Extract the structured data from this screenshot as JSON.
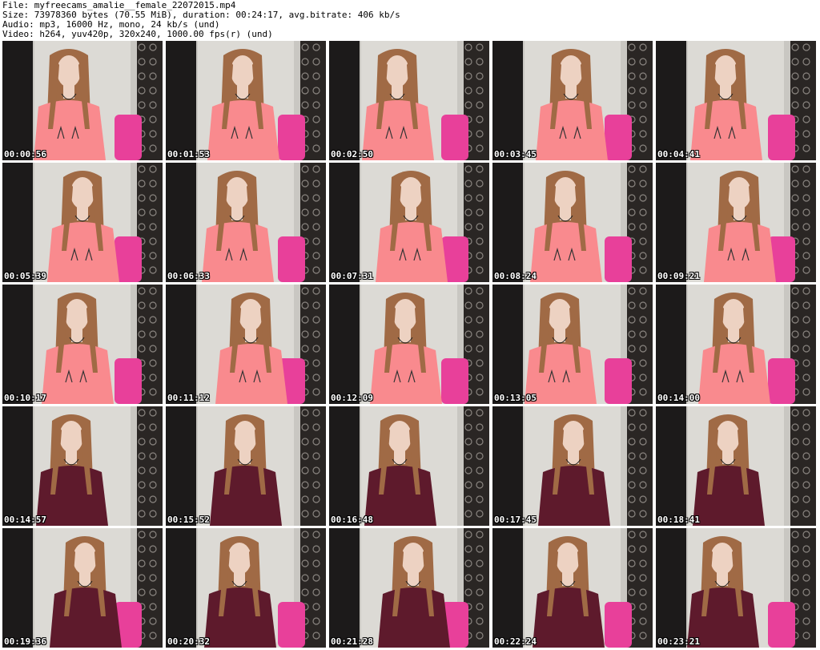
{
  "header": {
    "lines": [
      "File: myfreecams_amalie__female_22072015.mp4",
      "Size: 73978360 bytes (70.55 MiB), duration: 00:24:17, avg.bitrate: 406 kb/s",
      "Audio: mp3, 16000 Hz, mono, 24 kb/s (und)",
      "Video: h264, yuv420p, 320x240, 1000.00 fps(r) (und)"
    ]
  },
  "thumbnails": [
    {
      "timestamp": "00:00:56",
      "outfit": "pink-top"
    },
    {
      "timestamp": "00:01:53",
      "outfit": "pink-top"
    },
    {
      "timestamp": "00:02:50",
      "outfit": "pink-top"
    },
    {
      "timestamp": "00:03:45",
      "outfit": "pink-top"
    },
    {
      "timestamp": "00:04:41",
      "outfit": "pink-top"
    },
    {
      "timestamp": "00:05:39",
      "outfit": "pink-top"
    },
    {
      "timestamp": "00:06:33",
      "outfit": "pink-top"
    },
    {
      "timestamp": "00:07:31",
      "outfit": "pink-top"
    },
    {
      "timestamp": "00:08:24",
      "outfit": "pink-top"
    },
    {
      "timestamp": "00:09:21",
      "outfit": "pink-top"
    },
    {
      "timestamp": "00:10:17",
      "outfit": "pink-top"
    },
    {
      "timestamp": "00:11:12",
      "outfit": "pink-top"
    },
    {
      "timestamp": "00:12:09",
      "outfit": "pink-top"
    },
    {
      "timestamp": "00:13:05",
      "outfit": "pink-top"
    },
    {
      "timestamp": "00:14:00",
      "outfit": "pink-top"
    },
    {
      "timestamp": "00:14:57",
      "outfit": "maroon-dress"
    },
    {
      "timestamp": "00:15:52",
      "outfit": "maroon-dress"
    },
    {
      "timestamp": "00:16:48",
      "outfit": "maroon-dress"
    },
    {
      "timestamp": "00:17:45",
      "outfit": "maroon-dress"
    },
    {
      "timestamp": "00:18:41",
      "outfit": "maroon-dress"
    },
    {
      "timestamp": "00:19:36",
      "outfit": "maroon-dress"
    },
    {
      "timestamp": "00:20:32",
      "outfit": "maroon-dress"
    },
    {
      "timestamp": "00:21:28",
      "outfit": "maroon-dress"
    },
    {
      "timestamp": "00:22:24",
      "outfit": "maroon-dress"
    },
    {
      "timestamp": "00:23:21",
      "outfit": "maroon-dress"
    }
  ],
  "colors": {
    "pink_top": "#f98a8e",
    "maroon_dress": "#5e1a2c",
    "chair": "#e8409a",
    "wall": "#c9c7c2",
    "door": "#1c1a1a",
    "hair": "#a06a45",
    "skin": "#edd2c2",
    "wallpaper": "#2a2624"
  }
}
